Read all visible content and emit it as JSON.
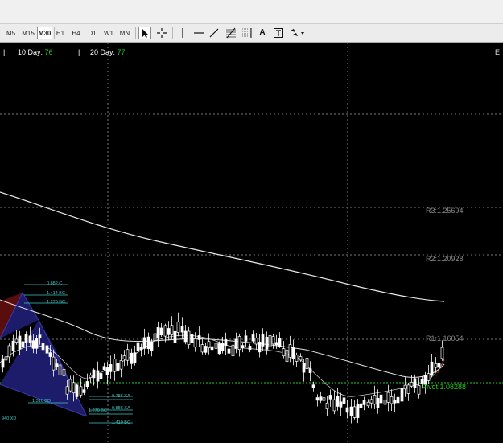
{
  "toolbar": {
    "timeframes": [
      "M5",
      "M15",
      "M30",
      "H1",
      "H4",
      "D1",
      "W1",
      "MN"
    ],
    "active_timeframe": "M30",
    "tools": [
      "cursor-icon",
      "crosshair-icon",
      "vertical-line-icon",
      "horizontal-line-icon",
      "trendline-icon",
      "fibonacci-icon",
      "grid-icon",
      "text-icon",
      "text-label-icon",
      "shapes-dropdown-icon"
    ],
    "text_tool_label": "A"
  },
  "header": {
    "ten_day_label": "10 Day:",
    "ten_day_value": "76",
    "twenty_day_label": "20 Day:",
    "twenty_day_value": "77",
    "right_marker": "E"
  },
  "levels": {
    "r3": "R3:1.25694",
    "r2": "R2:1.20928",
    "r1": "R1:1.16054",
    "pivot": "Pivot:1.08288"
  },
  "fib_labels": {
    "a": "0.882 C",
    "b": "1.414 BC",
    "c": "1.270 BC",
    "d": "1.316 BD",
    "e": "0.786 XA",
    "f": "0.886 XA",
    "g": "1.270 BC",
    "h": "1.410 BC",
    "i": "940 XD"
  },
  "colors": {
    "chart_bg": "#000000",
    "candles": "#ffffff",
    "ma": "#ffffff",
    "grid": "#7a7a7a",
    "pivot": "#22cc22",
    "level_text": "#8a8a8a",
    "fib": "#3fc7c7",
    "pattern_fill": "#1c1c6a",
    "pattern_red": "#5a0d0d"
  }
}
